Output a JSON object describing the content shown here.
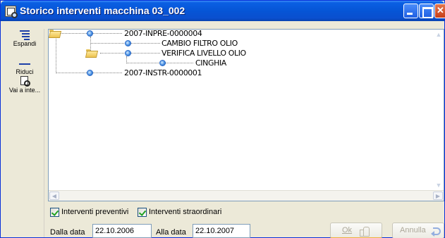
{
  "window": {
    "title": "Storico interventi macchina 03_002"
  },
  "toolbar": {
    "items": [
      {
        "label": "Espandi",
        "icon": "expand-icon"
      },
      {
        "label": "Riduci",
        "icon": "collapse-icon"
      },
      {
        "label": "Vai a inte...",
        "icon": "goto-icon"
      }
    ]
  },
  "tree": {
    "nodes": [
      {
        "label": "2007-INPRE-0000004",
        "level": 0
      },
      {
        "label": "CAMBIO FILTRO OLIO",
        "level": 1
      },
      {
        "label": "VERIFICA LIVELLO OLIO",
        "level": 1
      },
      {
        "label": "CINGHIA",
        "level": 2
      },
      {
        "label": "2007-INSTR-0000001",
        "level": 0
      }
    ]
  },
  "filters": {
    "preventivi_label": "Interventi preventivi",
    "preventivi_checked": true,
    "straordinari_label": "Interventi straordinari",
    "straordinari_checked": true,
    "from_label": "Dalla data",
    "from_value": "22.10.2006",
    "to_label": "Alla data",
    "to_value": "22.10.2007"
  },
  "buttons": {
    "ok_label": "Ok",
    "cancel_label": "Annulla"
  },
  "colors": {
    "titlebar": "#0655d6",
    "window_bg": "#ece9d8",
    "check": "#21a121",
    "ok_focus": "#f0b03e"
  }
}
